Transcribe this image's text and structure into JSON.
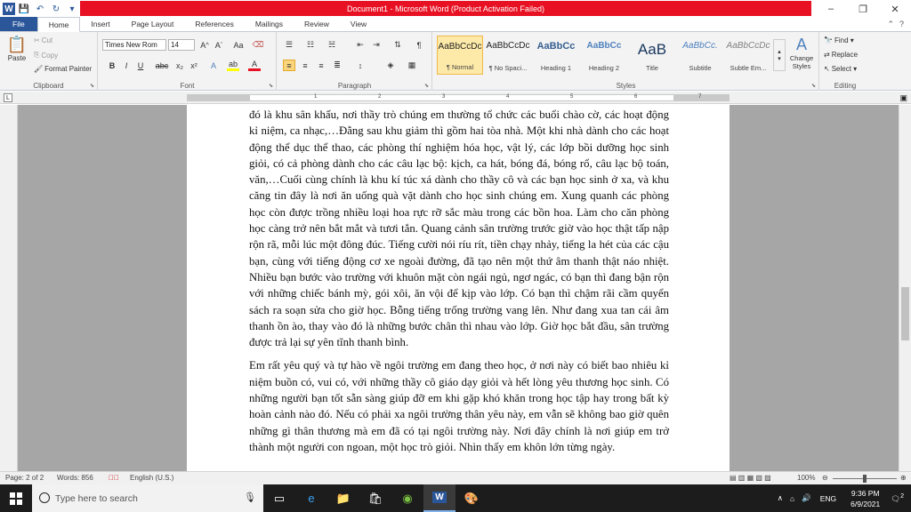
{
  "window": {
    "title": "Document1 - Microsoft Word (Product Activation Failed)",
    "controls": [
      "–",
      "❐",
      "✕"
    ]
  },
  "tabs": [
    "File",
    "Home",
    "Insert",
    "Page Layout",
    "References",
    "Mailings",
    "Review",
    "View"
  ],
  "active_tab": "Home",
  "ribbon": {
    "clipboard": {
      "label": "Clipboard",
      "paste": "Paste",
      "cut": "Cut",
      "copy": "Copy",
      "format_painter": "Format Painter"
    },
    "font": {
      "label": "Font",
      "font_name": "Times New Rom",
      "font_size": "14"
    },
    "paragraph": {
      "label": "Paragraph"
    },
    "styles": {
      "label": "Styles",
      "items": [
        {
          "preview": "AaBbCcDc",
          "name": "¶ Normal"
        },
        {
          "preview": "AaBbCcDc",
          "name": "¶ No Spaci..."
        },
        {
          "preview": "AaBbCc",
          "name": "Heading 1"
        },
        {
          "preview": "AaBbCc",
          "name": "Heading 2"
        },
        {
          "preview": "AaB",
          "name": "Title"
        },
        {
          "preview": "AaBbCc.",
          "name": "Subtitle"
        },
        {
          "preview": "AaBbCcDc",
          "name": "Subtle Em..."
        }
      ],
      "change_styles": "Change Styles"
    },
    "editing": {
      "label": "Editing",
      "find": "Find",
      "replace": "Replace",
      "select": "Select"
    }
  },
  "document": {
    "paragraphs": [
      "đó là khu sân khấu, nơi thầy trò chúng em thường tổ chức các buổi chào cờ, các hoạt động kỉ niệm, ca nhạc,…Đằng sau khu giảm thì gồm hai tòa nhà. Một khi nhà dành cho các hoạt động thể dục thể thao, các phòng thí nghiệm hóa học, vật lý, các lớp bồi dưỡng học sinh giỏi, có cả phòng dành cho các câu lạc bộ: kịch, ca hát, bóng đá, bóng rổ, câu lạc bộ toán, văn,…Cuối cùng chính là khu kí túc xá dành cho thầy cô và các bạn học sinh ở xa, và khu căng tin đây là nơi ăn uống quà vặt dành cho học sinh chúng em. Xung quanh các phòng học còn được trồng nhiều loại hoa rực rỡ sắc màu trong các bồn hoa. Làm cho căn phòng học càng trở nên bắt mắt và tươi tắn. Quang cảnh sân trường trước giờ vào học thật tấp nập rộn rã, mỗi lúc một đông đúc. Tiếng cười nói ríu rít, tiền chạy nhảy, tiếng la hét của các cậu bạn, cùng với tiếng động cơ xe ngoài đường, đã tạo nên một thứ âm thanh thật náo nhiệt. Nhiều bạn bước vào trường với khuôn mặt còn ngái ngủ, ngơ ngác, có bạn thì đang bận rộn với những chiếc bánh mỳ, gói xôi, ăn vội để kịp vào lớp. Có bạn thì chậm rãi cầm quyển sách ra soạn sửa cho giờ học. Bỗng tiếng trống trường vang lên. Như đang xua tan cái âm thanh ồn ào, thay vào đó là những bước chân thì nhau vào lớp. Giờ học bắt đầu, sân trường được trả lại sự yên tĩnh thanh bình.",
      "Em rất yêu quý và tự hào về ngôi trường em đang theo học, ở nơi này có biết bao nhiêu kỉ niệm buồn có, vui có, với những thầy cô giáo dạy giỏi và hết lòng yêu thương học sinh. Có những người bạn tốt sẵn sàng giúp đỡ em khi gặp khó khăn trong học tập hay trong bất kỳ hoàn cảnh nào đó. Nếu có phải xa ngôi trường thân yêu này, em vẫn sẽ không bao giờ quên những gì thân thương mà em đã có tại ngôi trường này. Nơi đây chính là nơi giúp em trở thành một người con ngoan, một học trò giỏi. Nhìn thấy em khôn lớn từng ngày."
    ]
  },
  "statusbar": {
    "page": "Page: 2 of 2",
    "words": "Words: 856",
    "language": "English (U.S.)",
    "zoom": "100%",
    "zoom_fraction": 0.5
  },
  "taskbar": {
    "search_placeholder": "Type here to search",
    "apps": [
      "task-view-icon",
      "edge-icon",
      "file-explorer-icon",
      "store-icon",
      "greenshot-icon",
      "word-icon",
      "paint-icon"
    ],
    "lang": "ENG",
    "time": "9:36 PM",
    "date": "6/9/2021",
    "notifications": "2"
  }
}
